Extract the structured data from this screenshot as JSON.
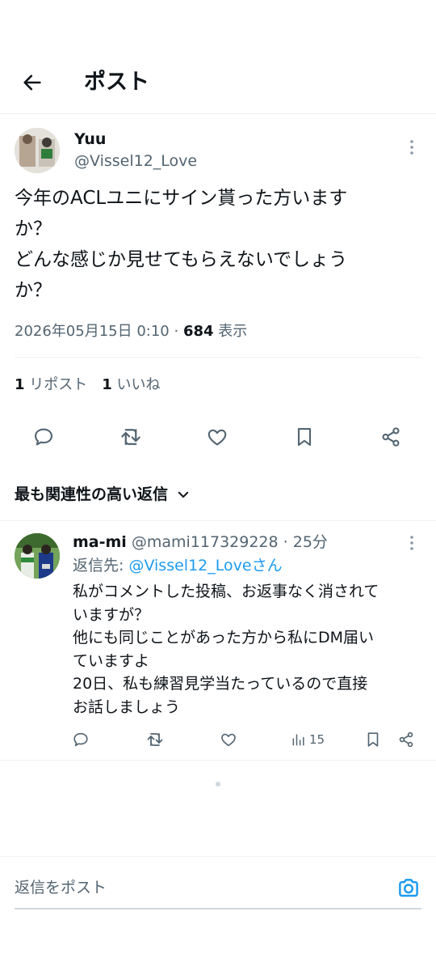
{
  "header": {
    "title": "ポスト"
  },
  "post": {
    "display_name": "Yuu",
    "handle": "@Vissel12_Love",
    "text_lines": [
      "今年のACLユニにサイン貰った方います",
      "か？",
      "どんな感じか見せてもらえないでしょう",
      "か？"
    ],
    "timestamp": "2026年05月15日 0:10",
    "separator": " · ",
    "views_count": "684",
    "views_label": " 表示",
    "reposts_count": "1",
    "reposts_label": " リポスト",
    "likes_count": "1",
    "likes_label": " いいね"
  },
  "sort": {
    "label": "最も関連性の高い返信"
  },
  "reply": {
    "display_name": "ma-mi",
    "handle": "@mami117329228",
    "separator": " · ",
    "time": "25分",
    "reply_to_prefix": "返信先: ",
    "reply_to_handle": "@Vissel12_Loveさん",
    "text_lines": [
      "私がコメントした投稿、お返事なく消されて",
      "いますが？",
      "他にも同じことがあった方から私にDM届い",
      "ていますよ",
      "20日、私も練習見学当たっているので直接",
      "お話しましょう"
    ],
    "views_count": "15"
  },
  "composer": {
    "placeholder": "返信をポスト"
  },
  "colors": {
    "link": "#1d9bf0",
    "muted": "#536471",
    "text": "#0f1419",
    "divider": "#eff3f4"
  },
  "icons": [
    "back-arrow-icon",
    "more-icon",
    "reply-icon",
    "repost-icon",
    "like-icon",
    "bookmark-icon",
    "share-icon",
    "chevron-down-icon",
    "views-icon",
    "camera-icon"
  ]
}
